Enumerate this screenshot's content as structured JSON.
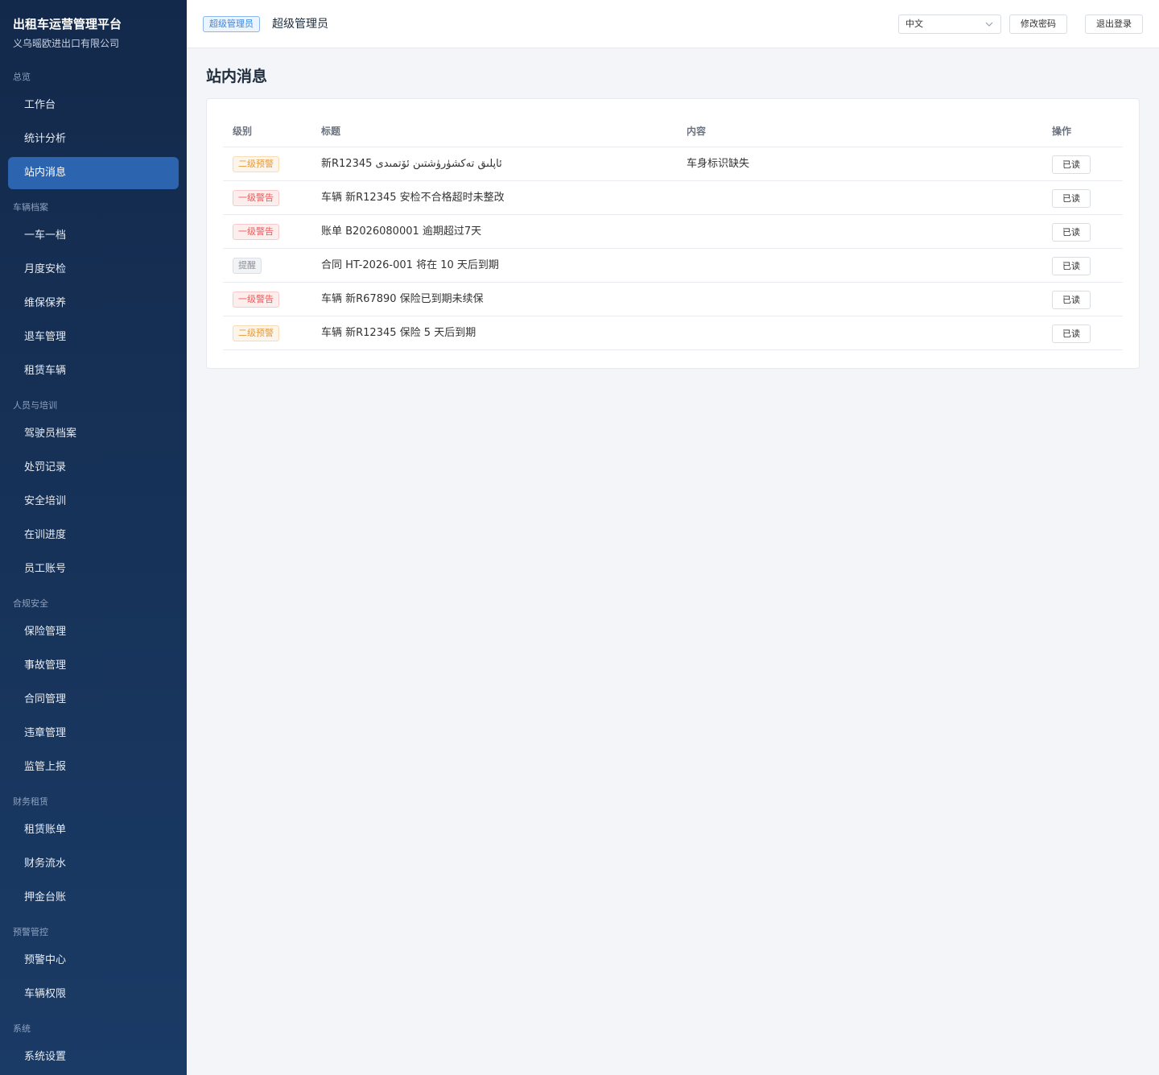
{
  "brand": {
    "title": "出租车运营管理平台",
    "subtitle": "义乌暚欧进出口有限公司"
  },
  "sidebar": {
    "groups": [
      {
        "label": "总览",
        "items": [
          {
            "label": "工作台"
          },
          {
            "label": "统计分析"
          },
          {
            "label": "站内消息",
            "active": true
          }
        ]
      },
      {
        "label": "车辆档案",
        "items": [
          {
            "label": "一车一档"
          },
          {
            "label": "月度安检"
          },
          {
            "label": "维保保养"
          },
          {
            "label": "退车管理"
          },
          {
            "label": "租赁车辆"
          }
        ]
      },
      {
        "label": "人员与培训",
        "items": [
          {
            "label": "驾驶员档案"
          },
          {
            "label": "处罚记录"
          },
          {
            "label": "安全培训"
          },
          {
            "label": "在训进度"
          },
          {
            "label": "员工账号"
          }
        ]
      },
      {
        "label": "合规安全",
        "items": [
          {
            "label": "保险管理"
          },
          {
            "label": "事故管理"
          },
          {
            "label": "合同管理"
          },
          {
            "label": "违章管理"
          },
          {
            "label": "监管上报"
          }
        ]
      },
      {
        "label": "财务租赁",
        "items": [
          {
            "label": "租赁账单"
          },
          {
            "label": "财务流水"
          },
          {
            "label": "押金台账"
          }
        ]
      },
      {
        "label": "预警管控",
        "items": [
          {
            "label": "预警中心"
          },
          {
            "label": "车辆权限"
          }
        ]
      },
      {
        "label": "系统",
        "items": [
          {
            "label": "系统设置"
          }
        ]
      }
    ]
  },
  "header": {
    "role_tag": "超级管理员",
    "user_name": "超级管理员",
    "language": "中文",
    "change_password": "修改密码",
    "logout": "退出登录"
  },
  "page": {
    "title": "站内消息"
  },
  "table": {
    "columns": {
      "level": "级别",
      "title": "标题",
      "content": "内容",
      "action": "操作"
    },
    "rows": [
      {
        "level": "二级预警",
        "level_type": "l2",
        "title": "新R12345 ئاپلىق تەكشۈرۈشتىن ئۆتمىدى",
        "content": "车身标识缺失",
        "action": "已读"
      },
      {
        "level": "一级警告",
        "level_type": "l1",
        "title": "车辆 新R12345 安检不合格超时未整改",
        "content": "",
        "action": "已读"
      },
      {
        "level": "一级警告",
        "level_type": "l1",
        "title": "账单 B2026080001 逾期超过7天",
        "content": "",
        "action": "已读"
      },
      {
        "level": "提醒",
        "level_type": "tip",
        "title": "合同 HT-2026-001 将在 10 天后到期",
        "content": "",
        "action": "已读"
      },
      {
        "level": "一级警告",
        "level_type": "l1",
        "title": "车辆 新R67890 保险已到期未续保",
        "content": "",
        "action": "已读"
      },
      {
        "level": "二级预警",
        "level_type": "l2",
        "title": "车辆 新R12345 保险 5 天后到期",
        "content": "",
        "action": "已读"
      }
    ]
  },
  "colors": {
    "sidebar_top": "#13294b",
    "sidebar_bottom": "#1a3b66",
    "active_item": "#2d64b0",
    "warning_l2": "#e69a3a",
    "warning_l1": "#ec5a5a"
  }
}
